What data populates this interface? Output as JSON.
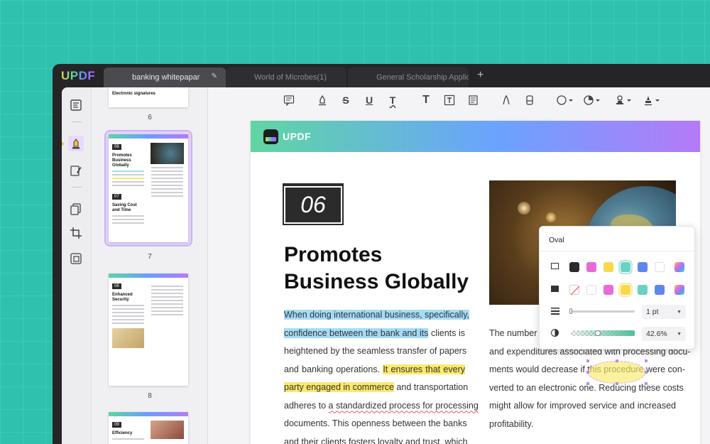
{
  "app": {
    "logo": "UPDF"
  },
  "tabs": [
    {
      "label": "banking whitepapar",
      "active": true
    },
    {
      "label": "World of Microbes(1)",
      "active": false
    },
    {
      "label": "General Scholarship Applic",
      "active": false
    }
  ],
  "thumbnails": [
    {
      "page": "6",
      "title": "Electronic signatures"
    },
    {
      "page": "7",
      "badge": "06",
      "title": "Promotes Business Globally",
      "badge2": "07",
      "title2": "Saving Cost and Time",
      "selected": true
    },
    {
      "page": "8",
      "badge": "08",
      "title": "Enhanced Security"
    },
    {
      "page": "",
      "badge": "09",
      "title": "Efficiency"
    }
  ],
  "document": {
    "header_logo": "UPDF",
    "section_number": "06",
    "title_line1": "Promotes",
    "title_line2": "Business Globally",
    "left_col": {
      "l1": "When doing international business, specifically,",
      "l2a": "confidence between the bank and its",
      "l2b": " clients is",
      "l3": "heightened by the seamless transfer of papers",
      "l4a": "and banking operations. ",
      "l4b": "It ensures that every",
      "l5a": "party engaged in commerce",
      "l5b": " and transportation",
      "l6a": "adheres to ",
      "l6b": "a standardized process for processing",
      "l7": "documents. This openness between the banks",
      "l8": "and their clients fosters loyalty and trust, which"
    },
    "right_col": {
      "l1a": "The number",
      "l2": "and expenditures associated with processing docu-",
      "l3a": "ments would decrease if this ",
      "l3b": "procedure",
      "l3c": " were con-",
      "l4": "verted to an electronic one. Reducing these costs",
      "l5": "might allow for improved service and increased",
      "l6": "profitability."
    }
  },
  "popup": {
    "title": "Oval",
    "stroke_colors": [
      "#2b2b2b",
      "#e86ad8",
      "#f8d84c",
      "#69d2c3",
      "#5e86ee",
      "#ffffff",
      "gradient"
    ],
    "fill_colors": [
      "none",
      "#ffffff",
      "#e86ad8",
      "#f8d84c",
      "#69d2c3",
      "#5e86ee",
      "gradient"
    ],
    "thickness": "1 pt",
    "opacity": "42.6%",
    "opacity_value": 0.426
  }
}
